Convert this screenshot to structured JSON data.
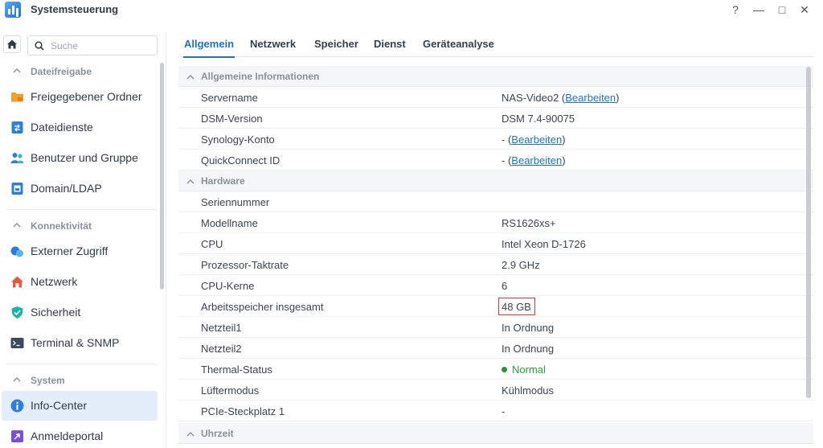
{
  "window": {
    "title": "Systemsteuerung",
    "controls": [
      "?",
      "—",
      "□",
      "✕"
    ]
  },
  "sidebar": {
    "search_placeholder": "Suche",
    "groups": [
      {
        "label": "Dateifreigabe",
        "items": [
          {
            "label": "Freigegebener Ordner",
            "icon": "shared-folder-icon"
          },
          {
            "label": "Dateidienste",
            "icon": "file-services-icon"
          },
          {
            "label": "Benutzer und Gruppe",
            "icon": "users-group-icon"
          },
          {
            "label": "Domain/LDAP",
            "icon": "domain-ldap-icon"
          }
        ]
      },
      {
        "label": "Konnektivität",
        "items": [
          {
            "label": "Externer Zugriff",
            "icon": "external-access-icon"
          },
          {
            "label": "Netzwerk",
            "icon": "network-home-icon"
          },
          {
            "label": "Sicherheit",
            "icon": "security-shield-icon"
          },
          {
            "label": "Terminal & SNMP",
            "icon": "terminal-icon"
          }
        ]
      },
      {
        "label": "System",
        "items": [
          {
            "label": "Info-Center",
            "icon": "info-icon",
            "active": true
          },
          {
            "label": "Anmeldeportal",
            "icon": "login-portal-icon"
          }
        ]
      }
    ]
  },
  "tabs": [
    "Allgemein",
    "Netzwerk",
    "Speicher",
    "Dienst",
    "Geräteanalyse"
  ],
  "active_tab": "Allgemein",
  "sections": [
    {
      "title": "Allgemeine Informationen",
      "rows": [
        {
          "key": "Servername",
          "value": "NAS-Video2",
          "link": "Bearbeiten"
        },
        {
          "key": "DSM-Version",
          "value": "DSM 7.4-90075"
        },
        {
          "key": "Synology-Konto",
          "value": "-",
          "link": "Bearbeiten"
        },
        {
          "key": "QuickConnect ID",
          "value": "-",
          "link": "Bearbeiten"
        }
      ]
    },
    {
      "title": "Hardware",
      "rows": [
        {
          "key": "Seriennummer",
          "value": ""
        },
        {
          "key": "Modellname",
          "value": "RS1626xs+"
        },
        {
          "key": "CPU",
          "value": "Intel Xeon D-1726"
        },
        {
          "key": "Prozessor-Taktrate",
          "value": "2.9 GHz"
        },
        {
          "key": "CPU-Kerne",
          "value": "6"
        },
        {
          "key": "Arbeitsspeicher insgesamt",
          "value": "48 GB",
          "highlighted": true
        },
        {
          "key": "Netzteil1",
          "value": "In Ordnung"
        },
        {
          "key": "Netzteil2",
          "value": "In Ordnung"
        },
        {
          "key": "Thermal-Status",
          "value": "Normal",
          "status": "ok"
        },
        {
          "key": "Lüftermodus",
          "value": "Kühlmodus"
        },
        {
          "key": "PCIe-Steckplatz 1",
          "value": "-"
        }
      ]
    },
    {
      "title": "Uhrzeit",
      "rows": []
    }
  ],
  "colors": {
    "accent": "#1e72c4",
    "status_ok": "#1f9b32",
    "highlight_border": "#d23c3c",
    "active_nav_bg": "#e4eefb"
  }
}
